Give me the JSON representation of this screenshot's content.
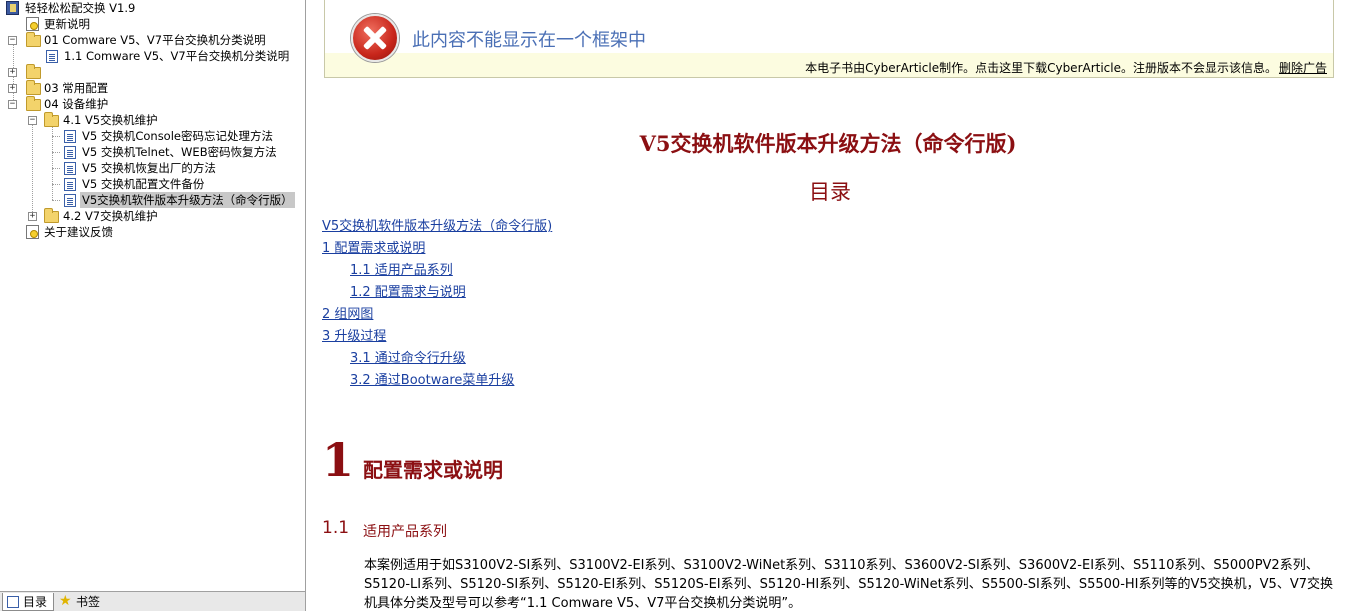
{
  "tree": {
    "root_title": "轻轻松松配交换 V1.9",
    "items": [
      {
        "label": "更新说明"
      },
      {
        "label": "01 Comware V5、V7平台交换机分类说明"
      },
      {
        "label": "1.1 Comware V5、V7平台交换机分类说明"
      },
      {
        "label": ""
      },
      {
        "label": "03 常用配置"
      },
      {
        "label": "04 设备维护"
      },
      {
        "label": "4.1 V5交换机维护"
      },
      {
        "label": "V5 交换机Console密码忘记处理方法"
      },
      {
        "label": "V5 交换机Telnet、WEB密码恢复方法"
      },
      {
        "label": "V5 交换机恢复出厂的方法"
      },
      {
        "label": "V5 交换机配置文件备份"
      },
      {
        "label": "V5交换机软件版本升级方法（命令行版）"
      },
      {
        "label": "4.2 V7交换机维护"
      },
      {
        "label": "关于建议反馈"
      }
    ],
    "selected_item": "V5交换机软件版本升级方法（命令行版）"
  },
  "tabs": [
    {
      "label": "目录",
      "icon": "toc-icon",
      "active": true
    },
    {
      "label": "书签",
      "icon": "star-icon",
      "active": false
    }
  ],
  "frame": {
    "message": "此内容不能显示在一个框架中",
    "icon": "error-x-icon",
    "cyber_note": "本电子书由CyberArticle制作。点击这里下载CyberArticle。注册版本不会显示该信息。",
    "delete_ad": "删除广告"
  },
  "document": {
    "title": "V5交换机软件版本升级方法（命令行版)",
    "toc_heading": "目录",
    "toc": [
      {
        "label": "V5交换机软件版本升级方法（命令行版)",
        "level": 0
      },
      {
        "label": "1 配置需求或说明",
        "level": 0
      },
      {
        "label": "1.1 适用产品系列",
        "level": 1
      },
      {
        "label": "1.2 配置需求与说明",
        "level": 1
      },
      {
        "label": "2 组网图",
        "level": 0
      },
      {
        "label": "3 升级过程",
        "level": 0
      },
      {
        "label": "3.1 通过命令行升级",
        "level": 1
      },
      {
        "label": "3.2 通过Bootware菜单升级",
        "level": 1
      }
    ],
    "section1_number": "1",
    "section1_title": "配置需求或说明",
    "section11_number": "1.1",
    "section11_title": "适用产品系列",
    "paragraph": "本案例适用于如S3100V2-SI系列、S3100V2-EI系列、S3100V2-WiNet系列、S3110系列、S3600V2-SI系列、S3600V2-EI系列、S5110系列、S5000PV2系列、S5120-LI系列、S5120-SI系列、S5120-EI系列、S5120S-EI系列、S5120-HI系列、S5120-WiNet系列、S5500-SI系列、S5500-HI系列等的V5交换机，V5、V7交换机具体分类及型号可以参考“1.1 Comware V5、V7平台交换机分类说明”。"
  },
  "colors": {
    "heading": "#8b0f12",
    "link": "#1a3fa0",
    "frame_bg": "#fcfce0",
    "frame_message": "#4a6fb5"
  }
}
